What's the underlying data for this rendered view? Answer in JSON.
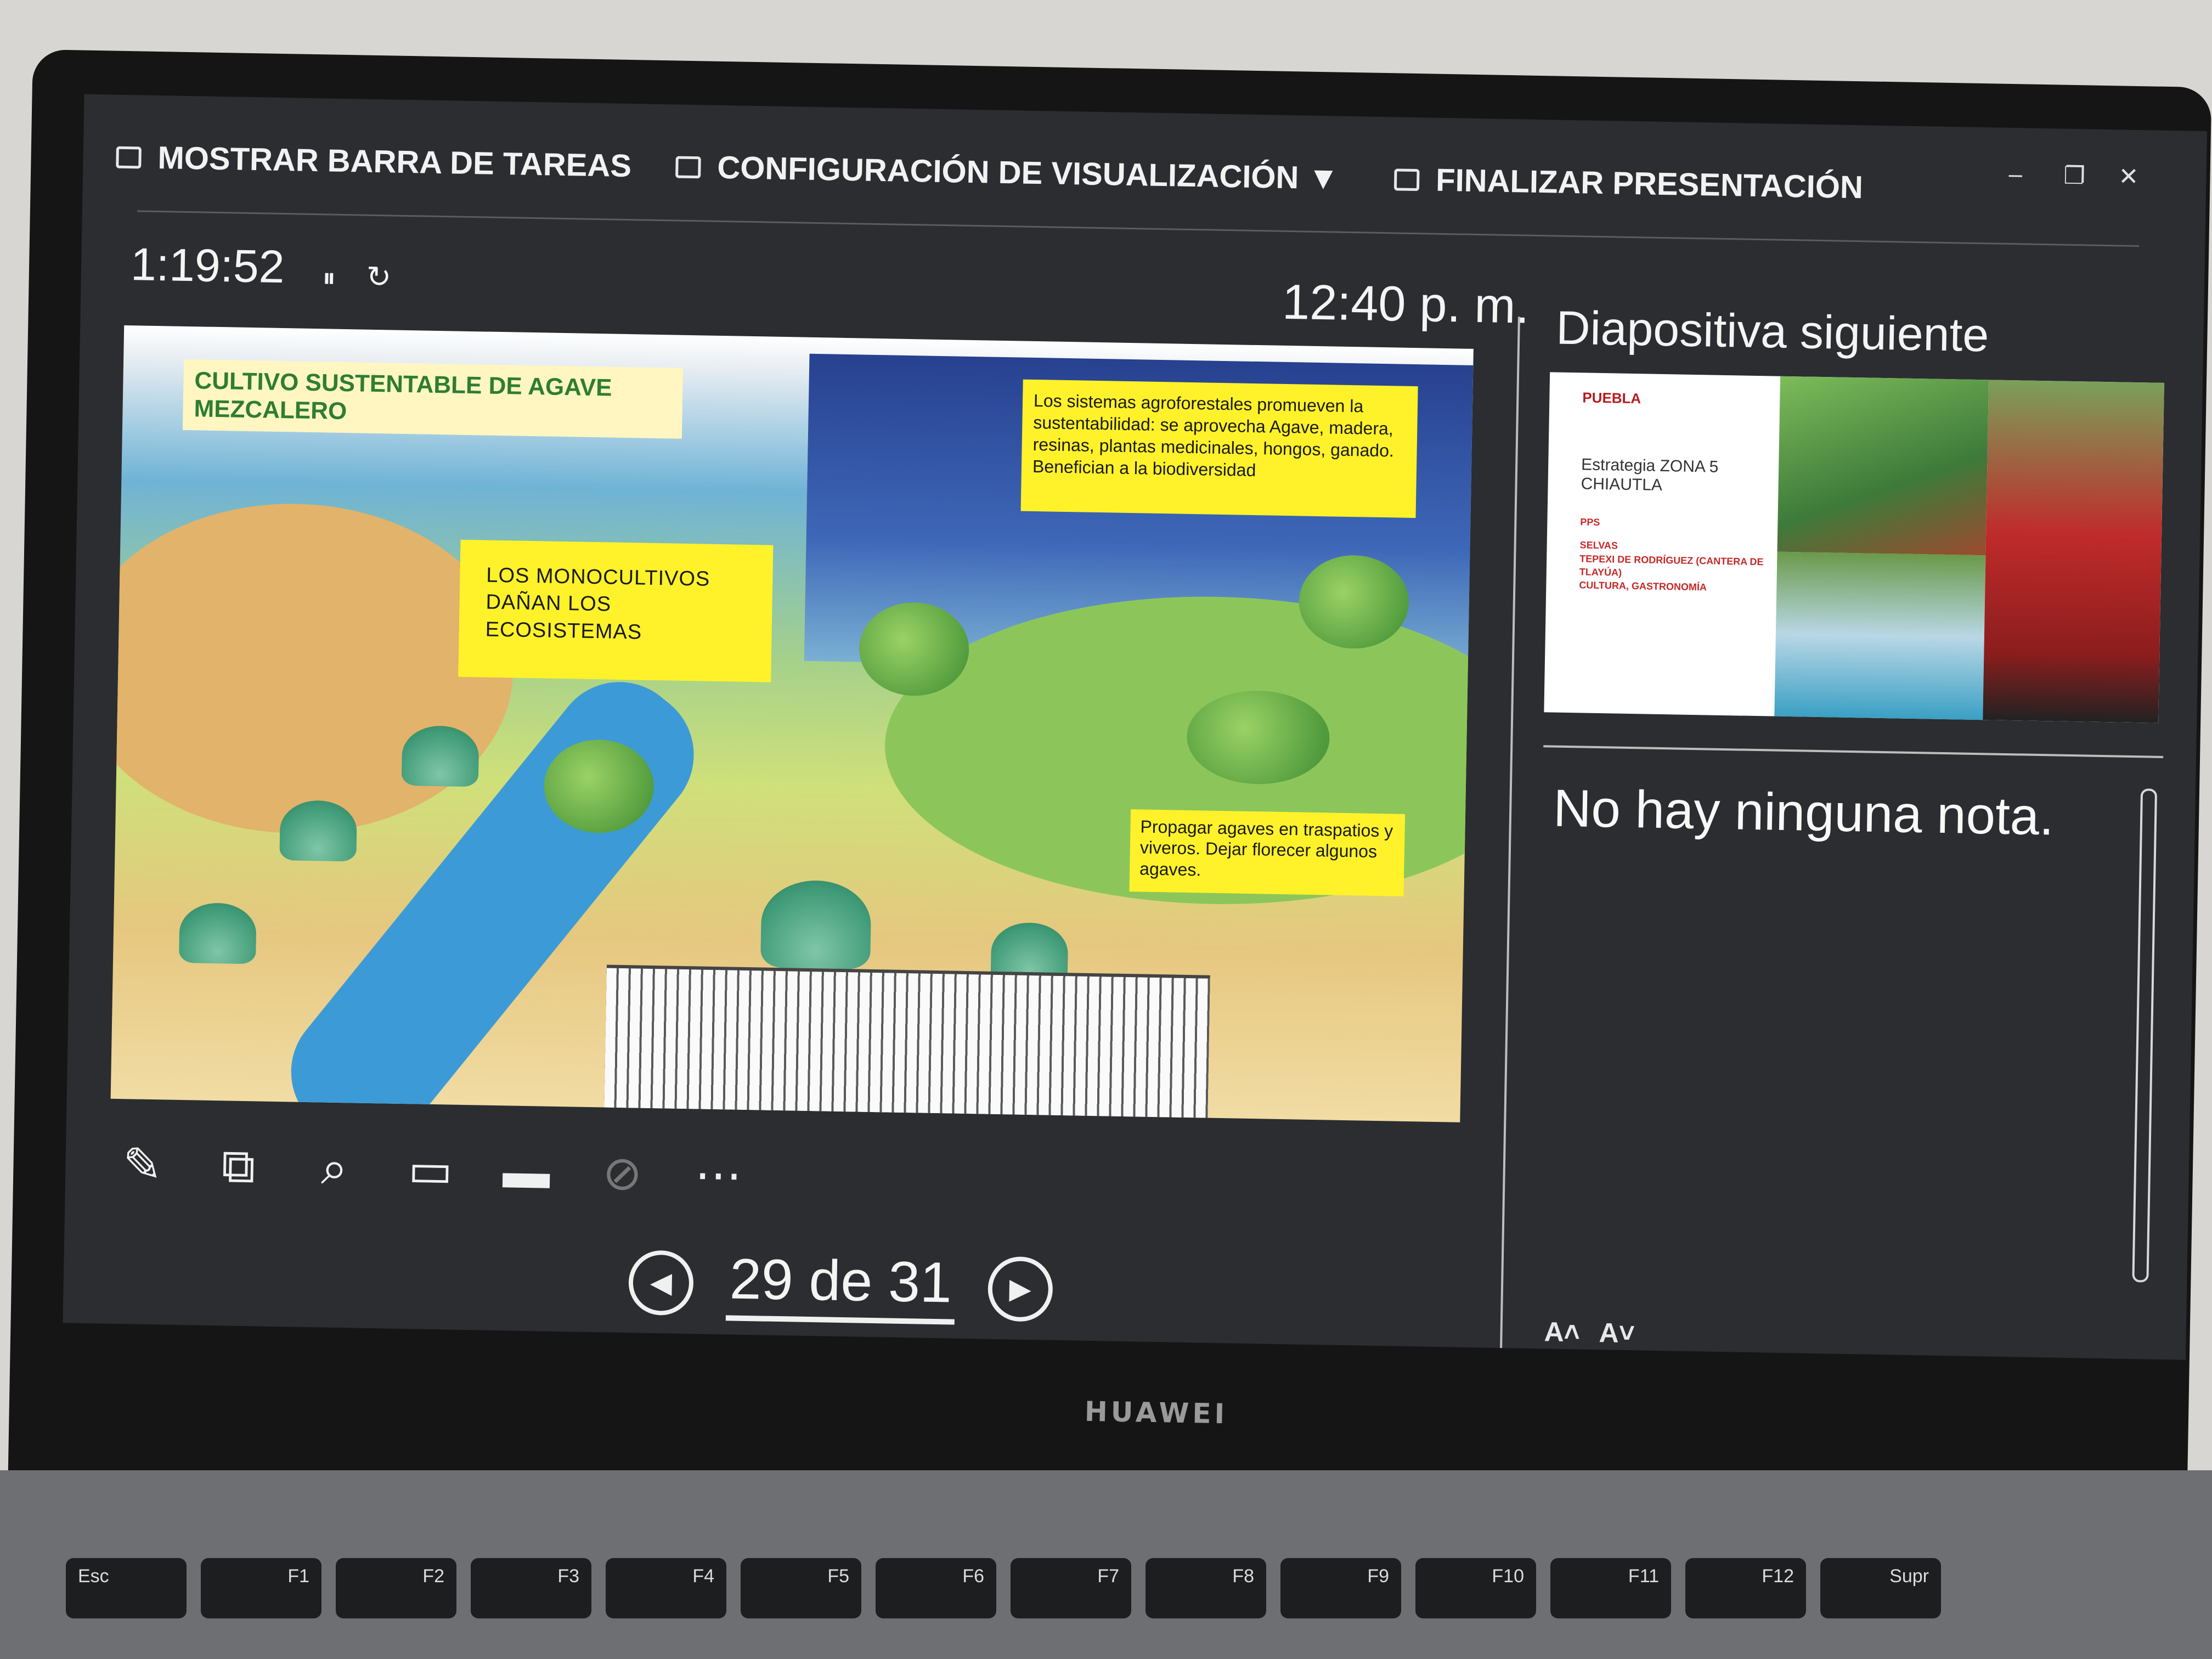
{
  "topbar": {
    "show_taskbar": "MOSTRAR BARRA DE TAREAS",
    "display_settings": "CONFIGURACIÓN DE VISUALIZACIÓN ▼",
    "end_show": "FINALIZAR PRESENTACIÓN",
    "window_controls": {
      "minimize": "–",
      "restore": "❐",
      "close": "✕"
    }
  },
  "timer": {
    "elapsed": "1:19:52",
    "pause_icon": "⏸",
    "reset_icon": "↻"
  },
  "clock": "12:40 p. m.",
  "slide": {
    "title": "CULTIVO SUSTENTABLE DE AGAVE MEZCALERO",
    "note_monocultivos": "LOS MONOCULTIVOS DAÑAN LOS ECOSISTEMAS",
    "note_agroforestales": "Los sistemas agroforestales promueven la sustentabilidad: se aprovecha Agave, madera, resinas, plantas medicinales, hongos, ganado. Benefician a la biodiversidad",
    "note_propagar": "Propagar agaves en traspatios y viveros. Dejar florecer algunos agaves."
  },
  "tools": [
    {
      "name": "pen-tool-icon",
      "glyph": "✎"
    },
    {
      "name": "see-all-slides-icon",
      "glyph": "⧉"
    },
    {
      "name": "zoom-icon",
      "glyph": "⌕"
    },
    {
      "name": "black-screen-icon",
      "glyph": "▭"
    },
    {
      "name": "subtitles-icon",
      "glyph": "▬"
    },
    {
      "name": "camera-off-icon",
      "glyph": "⊘"
    },
    {
      "name": "more-options-icon",
      "glyph": "⋯"
    }
  ],
  "nav": {
    "prev": "◀",
    "next": "▶",
    "counter": "29 de 31"
  },
  "next_slide": {
    "label": "Diapositiva siguiente",
    "logo": "PUEBLA",
    "heading": "Estrategia ZONA 5 CHIAUTLA",
    "list_1": "PPS",
    "list_2": "SELVAS",
    "list_3": "TEPEXI DE RODRÍGUEZ (CANTERA DE TLAYÚA)",
    "list_4": "CULTURA, GASTRONOMÍA"
  },
  "notes": {
    "text": "No hay ninguna nota.",
    "increase_font": "A˄",
    "decrease_font": "A˅"
  },
  "hardware": {
    "brand": "HUAWEI",
    "keys": [
      "Esc",
      "F1",
      "F2",
      "F3",
      "F4",
      "F5",
      "F6",
      "F7",
      "F8",
      "F9",
      "F10",
      "F11",
      "F12",
      "Supr"
    ]
  }
}
